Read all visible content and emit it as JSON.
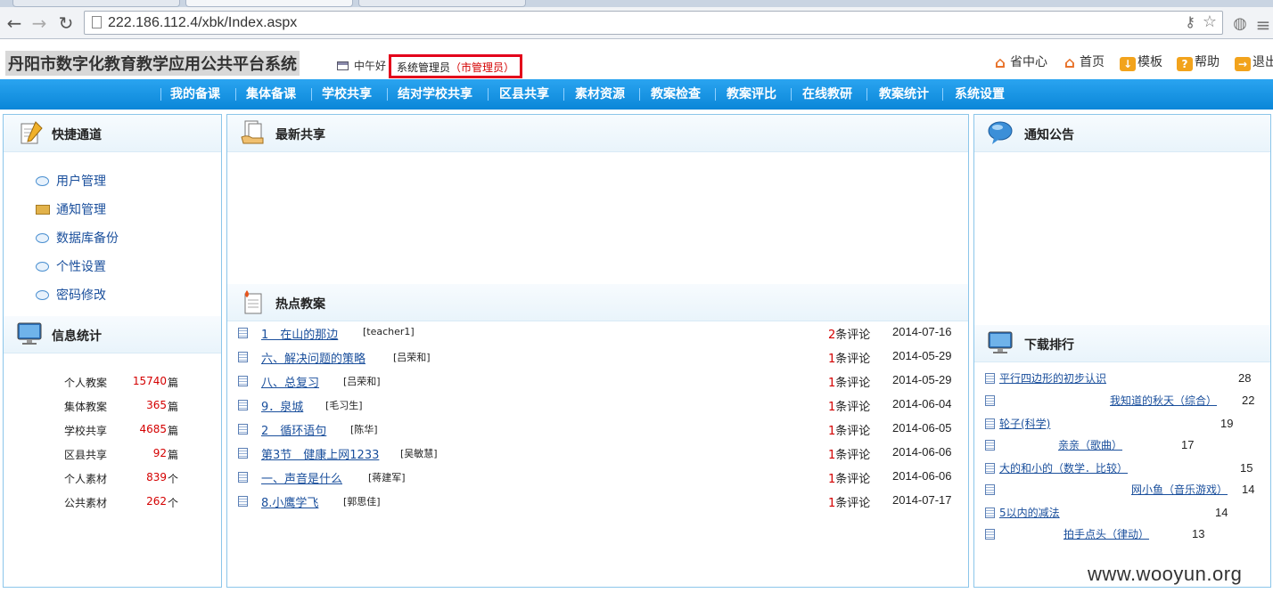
{
  "browser": {
    "url": "222.186.112.4/xbk/Index.aspx"
  },
  "header": {
    "site_title": "丹阳市数字化教育教学应用公共平台系统",
    "greeting": "中午好",
    "user_name": "系统管理员",
    "user_role": "（市管理员）",
    "links": [
      {
        "label": "省中心",
        "icon": "home-icon"
      },
      {
        "label": "首页",
        "icon": "home-icon"
      },
      {
        "label": "模板",
        "icon": "download-icon"
      },
      {
        "label": "帮助",
        "icon": "help-icon"
      },
      {
        "label": "退出",
        "icon": "exit-icon"
      }
    ]
  },
  "nav": {
    "items": [
      "我的备课",
      "集体备课",
      "学校共享",
      "结对学校共享",
      "区县共享",
      "素材资源",
      "教案检查",
      "教案评比",
      "在线教研",
      "教案统计",
      "系统设置"
    ]
  },
  "quick": {
    "title": "快捷通道",
    "items": [
      "用户管理",
      "通知管理",
      "数据库备份",
      "个性设置",
      "密码修改"
    ]
  },
  "stats": {
    "title": "信息统计",
    "rows": [
      {
        "label": "个人教案",
        "value": "15740",
        "unit": "篇"
      },
      {
        "label": "集体教案",
        "value": "365",
        "unit": "篇"
      },
      {
        "label": "学校共享",
        "value": "4685",
        "unit": "篇"
      },
      {
        "label": "区县共享",
        "value": "92",
        "unit": "篇"
      },
      {
        "label": "个人素材",
        "value": "839",
        "unit": "个"
      },
      {
        "label": "公共素材",
        "value": "262",
        "unit": "个"
      }
    ]
  },
  "latest": {
    "title": "最新共享"
  },
  "hot": {
    "title": "热点教案",
    "comment_suffix": "条评论",
    "rows": [
      {
        "title": "1　在山的那边",
        "author": "[teacher1]",
        "comments": "2",
        "date": "2014-07-16"
      },
      {
        "title": "六、解决问题的策略",
        "author": "[吕荣和]",
        "comments": "1",
        "date": "2014-05-29"
      },
      {
        "title": "八、总复习",
        "author": "[吕荣和]",
        "comments": "1",
        "date": "2014-05-29"
      },
      {
        "title": "9．泉城",
        "author": "[毛习生]",
        "comments": "1",
        "date": "2014-06-04"
      },
      {
        "title": "2　循环语句",
        "author": "[陈华]",
        "comments": "1",
        "date": "2014-06-05"
      },
      {
        "title": "第3节　健康上网1233",
        "author": "[吴敏慧]",
        "comments": "1",
        "date": "2014-06-06"
      },
      {
        "title": "一、声音是什么",
        "author": "[蒋建军]",
        "comments": "1",
        "date": "2014-06-06"
      },
      {
        "title": "8.小鹰学飞",
        "author": "[郭思佳]",
        "comments": "1",
        "date": "2014-07-17"
      }
    ]
  },
  "notice": {
    "title": "通知公告"
  },
  "downloads": {
    "title": "下载排行",
    "rows": [
      {
        "title": "平行四边形的初步认识",
        "count": "28"
      },
      {
        "title": "我知道的秋天（综合）",
        "count": "22"
      },
      {
        "title": "轮子(科学)",
        "count": "19"
      },
      {
        "title": "亲亲（歌曲）",
        "count": "17"
      },
      {
        "title": "大的和小的（数学．比较）",
        "count": "15"
      },
      {
        "title": "网小鱼（音乐游戏）",
        "count": "14"
      },
      {
        "title": "5以内的减法",
        "count": "14"
      },
      {
        "title": "拍手点头（律动）",
        "count": "13"
      }
    ]
  },
  "watermark": "www.wooyun.org"
}
